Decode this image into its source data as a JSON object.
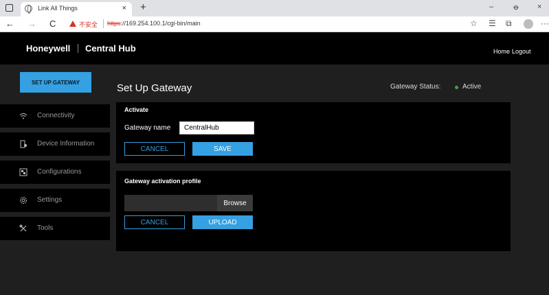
{
  "browser": {
    "tab_title": "Link All Things",
    "tab_close": "×",
    "new_tab": "+",
    "minimize": "–",
    "restore": "ꝋ",
    "close": "×",
    "back": "←",
    "forward": "→",
    "reload": "C",
    "security_warning": "不安全",
    "url_scheme": "https",
    "url_rest": "://169.254.100.1/cgi-bin/main",
    "more": "···"
  },
  "header": {
    "brand": "Honeywell",
    "product": "Central Hub",
    "links": [
      "Home",
      "Logout"
    ]
  },
  "sidebar": {
    "primary_button": "SET UP GATEWAY",
    "items": [
      {
        "label": "Connectivity",
        "icon": "wifi-icon"
      },
      {
        "label": "Device Information",
        "icon": "device-icon"
      },
      {
        "label": "Configurations",
        "icon": "configurations-icon"
      },
      {
        "label": "Settings",
        "icon": "gear-icon"
      },
      {
        "label": "Tools",
        "icon": "tools-icon"
      }
    ]
  },
  "main": {
    "title": "Set Up Gateway",
    "status_label": "Gateway Status:",
    "status_value": "Active",
    "status_color": "#3aa64a",
    "activate": {
      "title": "Activate",
      "name_label": "Gateway name",
      "name_value": "CentralHub",
      "cancel": "CANCEL",
      "save": "SAVE"
    },
    "profile": {
      "title": "Gateway activation profile",
      "file_value": "",
      "browse": "Browse",
      "cancel": "CANCEL",
      "upload": "UPLOAD"
    }
  },
  "colors": {
    "accent": "#35a0e2",
    "background": "#1f1f1f",
    "panel": "#000000"
  }
}
